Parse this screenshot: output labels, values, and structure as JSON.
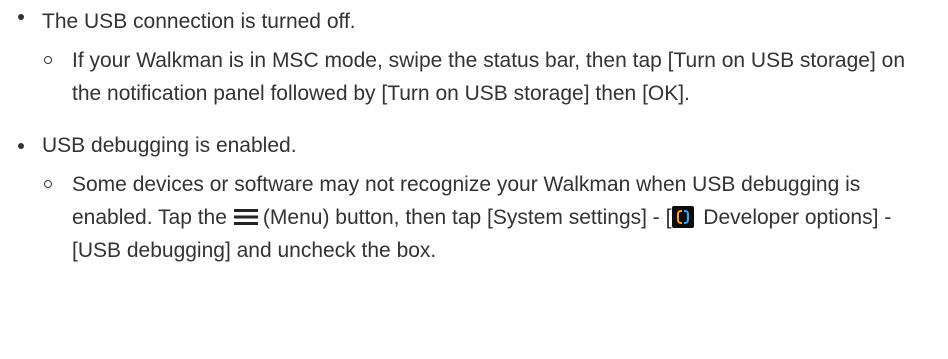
{
  "items": [
    {
      "text": "The USB connection is turned off.",
      "sub": [
        {
          "text": "If your Walkman is in MSC mode, swipe the status bar, then tap [Turn on USB storage] on the notification panel followed by [Turn on USB storage] then [OK]."
        }
      ]
    },
    {
      "text": "USB debugging is enabled.",
      "sub": [
        {
          "text_before_menu": "Some devices or software may not recognize your Walkman when USB debugging is enabled. Tap the",
          "menu_icon": "menu-icon",
          "text_after_menu_before_dev": "(Menu) button, then tap [System settings] - [",
          "developer_icon": "developer-options-icon",
          "text_after_dev": "Developer options] - [USB debugging] and uncheck the box."
        }
      ]
    }
  ],
  "colors": {
    "text": "#333333",
    "background": "#ffffff",
    "dev_icon_left": "#ff9d1a",
    "dev_icon_right": "#2da7ff"
  }
}
